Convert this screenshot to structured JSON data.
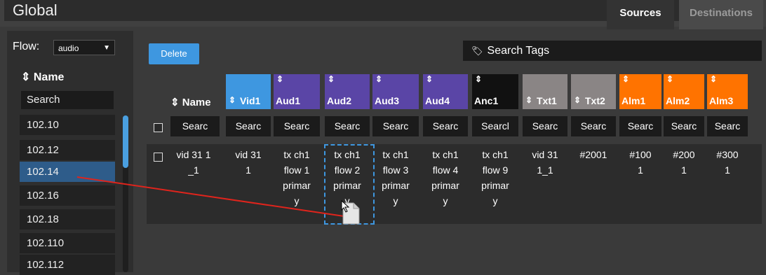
{
  "header": {
    "title": "Global",
    "tabs": [
      "Sources",
      "Destinations"
    ],
    "active_tab": "Sources"
  },
  "sidebar": {
    "flow_label": "Flow:",
    "flow_value": "audio",
    "name_header": "Name",
    "search_placeholder": "Search",
    "items": [
      "102.10",
      "102.12",
      "102.14",
      "102.16",
      "102.18",
      "102.110",
      "102.112"
    ],
    "selected_item": "102.14"
  },
  "toolbar": {
    "delete_label": "Delete",
    "search_tags_placeholder": "Search Tags"
  },
  "table": {
    "name_header": "Name",
    "columns": [
      {
        "label": "Vid1",
        "color": "#3e97e0"
      },
      {
        "label": "Aud1",
        "color": "#5a45a6"
      },
      {
        "label": "Aud2",
        "color": "#5a45a6"
      },
      {
        "label": "Aud3",
        "color": "#5a45a6"
      },
      {
        "label": "Aud4",
        "color": "#5a45a6"
      },
      {
        "label": "Anc1",
        "color": "#111111"
      },
      {
        "label": "Txt1",
        "color": "#8a8585"
      },
      {
        "label": "Txt2",
        "color": "#8a8585"
      },
      {
        "label": "Alm1",
        "color": "#ff7300"
      },
      {
        "label": "Alm2",
        "color": "#ff7300"
      },
      {
        "label": "Alm3",
        "color": "#ff7300"
      }
    ],
    "filter_texts": [
      "Searc",
      "Searc",
      "Searc",
      "Searc",
      "Searc",
      "Searc",
      "Searcl",
      "Searc",
      "Searc",
      "Searc",
      "Searc",
      "Searc"
    ],
    "row": {
      "name": [
        "vid 31 1",
        "_1"
      ],
      "cells": [
        [
          "vid 31",
          "1"
        ],
        [
          "tx ch1",
          "flow 1",
          "primar",
          "y"
        ],
        [
          "tx ch1",
          "flow 2",
          "primar",
          "y"
        ],
        [
          "tx ch1",
          "flow 3",
          "primar",
          "y"
        ],
        [
          "tx ch1",
          "flow 4",
          "primar",
          "y"
        ],
        [
          "tx ch1",
          "flow 9",
          "primar",
          "y"
        ],
        [
          "vid 31",
          "1_1"
        ],
        [
          "#2001"
        ],
        [
          "#100",
          "1"
        ],
        [
          "#200",
          "1"
        ],
        [
          "#300",
          "1"
        ]
      ]
    }
  },
  "icons": {
    "sort": "sort-icon",
    "tag": "tag-icon",
    "file": "file-icon",
    "cursor": "pointer-cursor-icon"
  },
  "colors": {
    "accent": "#3e97e0",
    "drag_line": "#e0241c"
  }
}
